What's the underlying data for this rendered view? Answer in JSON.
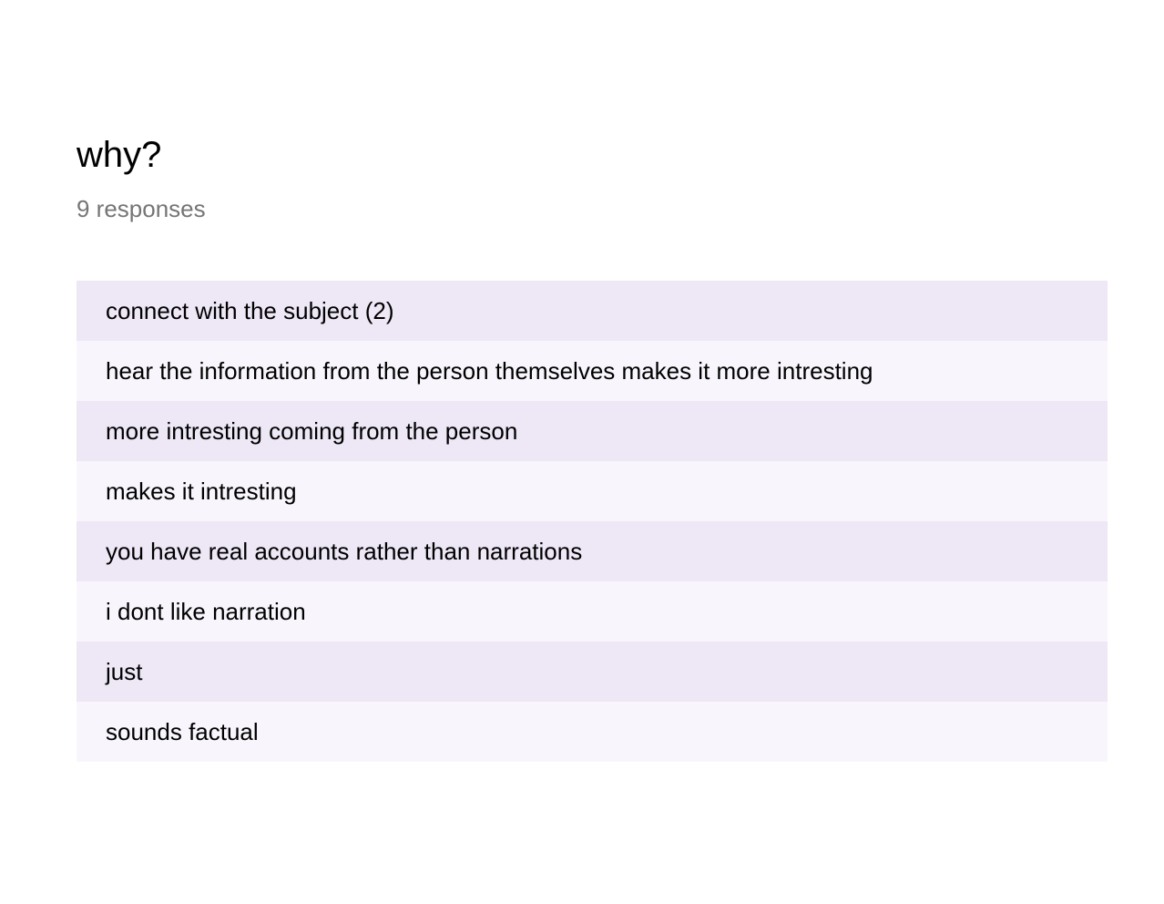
{
  "question": {
    "title": "why?",
    "response_count": "9 responses"
  },
  "responses": [
    "connect with the subject (2)",
    "hear the information from the person themselves makes it more intresting",
    "more intresting coming from the person",
    "makes it intresting",
    "you have real accounts rather than narrations",
    "i dont like narration",
    "just",
    "sounds factual"
  ],
  "colors": {
    "row_odd": "#ede7f6",
    "row_even": "#f8f6fc",
    "muted_text": "#757575"
  }
}
